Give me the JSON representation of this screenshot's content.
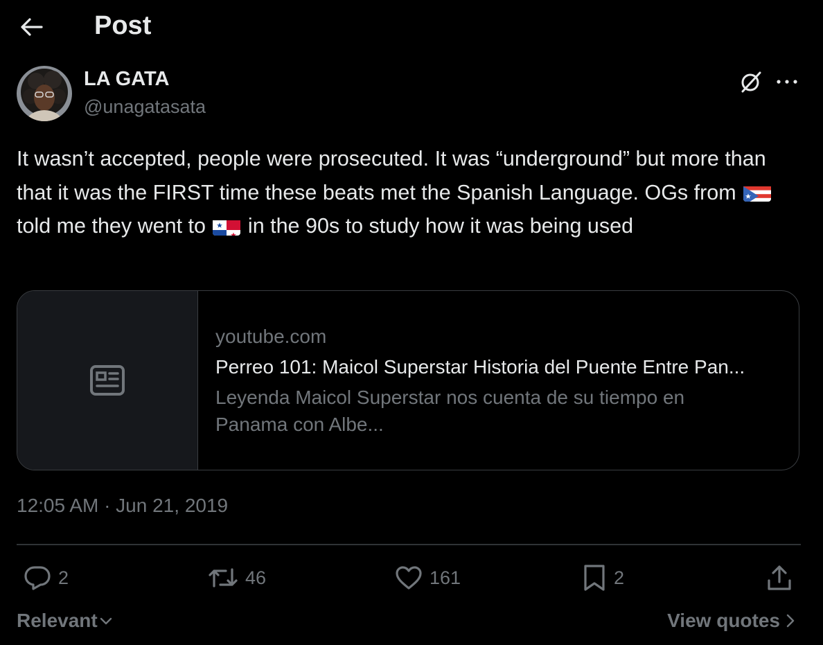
{
  "header": {
    "title": "Post"
  },
  "author": {
    "display_name": "LA GATA",
    "handle": "@unagatasata"
  },
  "tweet": {
    "text_part1": "It wasn’t accepted, people were prosecuted. It was “underground” but more than that it was the FIRST time these beats met the Spanish Language. OGs from ",
    "text_part2": " told me they went to ",
    "text_part3": " in the 90s to study how it was being used",
    "flag1": "puerto-rico-flag-icon",
    "flag2": "panama-flag-icon"
  },
  "card": {
    "domain": "youtube.com",
    "title": "Perreo 101: Maicol Superstar Historia del Puente Entre Pan...",
    "description": "Leyenda Maicol Superstar nos cuenta de su tiempo en Panama con Albe..."
  },
  "timestamp": "12:05 AM · Jun 21, 2019",
  "actions": {
    "replies": "2",
    "reposts": "46",
    "likes": "161",
    "bookmarks": "2"
  },
  "footer": {
    "sort_label": "Relevant",
    "view_quotes": "View quotes"
  },
  "colors": {
    "background": "#000000",
    "text": "#e7e9ea",
    "muted": "#71767b",
    "border": "#2f3336"
  }
}
